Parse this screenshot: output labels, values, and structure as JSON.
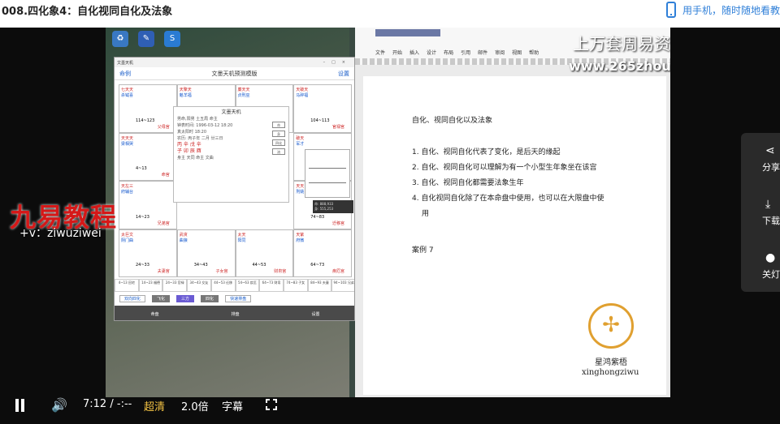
{
  "page": {
    "title": "008.四化象4：自化视同自化及法象",
    "mobile_link": "用手机，随时随地看教"
  },
  "app": {
    "window_title": "文墨天机",
    "back": "命例",
    "title": "文墨天机预测模版",
    "settings": "设置",
    "palaces": [
      {
        "stars": "七天天",
        "bright": "杀钺喜",
        "age": "114~123",
        "name": "父母宫"
      },
      {
        "stars": "天擎天",
        "bright": "魁羊福",
        "age": "4~13",
        "name": "福德宫"
      },
      {
        "stars": "廉天天",
        "bright": "贞刑巫",
        "age": "114~123",
        "name": "田宅宫"
      },
      {
        "stars": "天破天",
        "bright": "马碎福",
        "age": "104~113",
        "name": "官禄宫"
      },
      {
        "stars": "天天天",
        "bright": "梁相哭",
        "age": "4~13",
        "name": "命宫"
      },
      {
        "stars": "破天",
        "bright": "军才",
        "age": "94~103",
        "name": "交友宫"
      },
      {
        "stars": "天左三",
        "bright": "府辅台",
        "age": "14~23",
        "name": "兄弟宫"
      },
      {
        "stars": "天天",
        "bright": "刑姚",
        "age": "74~83",
        "name": "迁移宫"
      },
      {
        "stars": "太巨文",
        "bright": "阴门曲",
        "age": "24~33",
        "name": "夫妻宫"
      },
      {
        "stars": "武贪",
        "bright": "曲狼",
        "age": "34~43",
        "name": "子女宫"
      },
      {
        "stars": "太天",
        "bright": "阳同",
        "age": "44~53",
        "name": "财帛宫"
      },
      {
        "stars": "天紫",
        "bright": "府微",
        "age": "64~73",
        "name": "疾厄宫"
      }
    ],
    "center": {
      "title": "文墨天机",
      "l1": "男命,阳男 土五局 命主",
      "l2": "钟表时间: 1996-03-12 18:20",
      "l3": "真太阳时 18:20",
      "l4": "农历: 丙子年 二月 廿三日",
      "stems": "丙 辛 戊 辛",
      "branches": "子 卯 辰 酉",
      "l5": "身主 天同 命主 文曲",
      "btns": [
        "命",
        "身",
        "四化",
        "流"
      ]
    },
    "tip": [
      "命: 888,933",
      "身: 555,253"
    ],
    "row": [
      "4~13 田宅",
      "14~23 福德",
      "24~33 官禄",
      "34~43 交友",
      "44~53 迁移",
      "54~63 疾厄",
      "64~73 财帛",
      "74~83 子女",
      "84~93 夫妻",
      "94~103 兄弟"
    ],
    "ctl": {
      "left": "双向四化",
      "seg": [
        "飞化",
        "三方",
        "四化"
      ],
      "right": "快速排盘"
    },
    "nav": [
      "命盘",
      "排盘",
      "设置"
    ]
  },
  "word": {
    "menu": [
      "文件",
      "开始",
      "插入",
      "设计",
      "布局",
      "引用",
      "邮件",
      "审阅",
      "视图",
      "帮助"
    ],
    "heading": "自化、视同自化以及法象",
    "items": [
      "1. 自化、视同自化代表了变化，是后天的缘起",
      "2. 自化、视同自化可以理解为有一个小型生年象坐在该宫",
      "3. 自化、视同自化都需要法象生年",
      "4. 自化视同自化除了在本命盘中使用，也可以在大限盘中使",
      "用"
    ],
    "case": "案例 7"
  },
  "watermark": {
    "line1": "上万套周易资料教程",
    "line2": "www.265zhouyiw.com",
    "left_big": "九易教程",
    "left_wx": "+v：ziwuziwei",
    "logo_name": "星鸿紫梧",
    "logo_pinyin": "xinghongziwu"
  },
  "controls": {
    "time": "7:12",
    "sep": "/",
    "total": "-:--",
    "quality": "超清",
    "speed": "2.0倍",
    "subtitle": "字幕"
  },
  "side": [
    {
      "label": "分享"
    },
    {
      "label": "下载"
    },
    {
      "label": "关灯"
    }
  ]
}
